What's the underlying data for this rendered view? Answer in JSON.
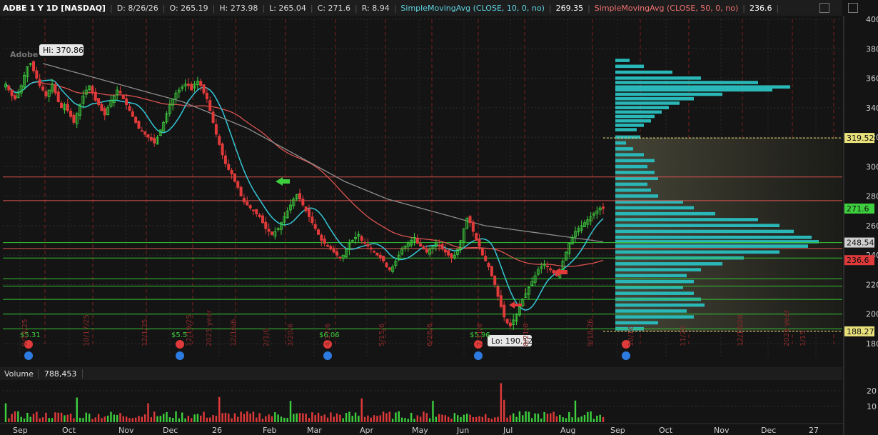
{
  "header": {
    "symbol": "ADBE 1 Y 1D [NASDAQ]",
    "date": "D: 8/26/26",
    "open": "O: 265.19",
    "high": "H: 273.98",
    "low": "L: 265.04",
    "close": "C: 271.6",
    "range": "R: 8.94",
    "sma10_label": "SimpleMovingAvg (CLOSE, 10, 0, no)",
    "sma10_value": "269.35",
    "sma50_label": "SimpleMovingAvg (CLOSE, 50, 0, no)",
    "sma50_value": "236.6",
    "logo_text": "Adobe"
  },
  "volume_header": {
    "label": "Volume",
    "value": "788,453"
  },
  "colors": {
    "up": "#3ecf3e",
    "down": "#e03a3a",
    "sma10": "#34c7d6",
    "sma50": "#d9534f",
    "sma200": "#8c8c8c",
    "profile": "#2ab7b7",
    "hline_red": "#d9534f",
    "hline_green": "#35c435",
    "hline_yellow": "#e8e07a"
  },
  "chart_data": {
    "type": "candlestick",
    "symbol": "ADBE",
    "price_axis": {
      "min": 180,
      "max": 400,
      "ticks": [
        180,
        200,
        220,
        240,
        260,
        280,
        300,
        320,
        340,
        360,
        380,
        400
      ]
    },
    "volume_axis": {
      "ticks": [
        10,
        20
      ]
    },
    "x_labels": [
      "Sep",
      "Oct",
      "Nov",
      "Dec",
      "26",
      "Feb",
      "Mar",
      "Apr",
      "May",
      "Jun",
      "Jul",
      "Aug",
      "Sep",
      "Oct",
      "Nov",
      "Dec",
      "27"
    ],
    "highlighted_prices": [
      {
        "value": "319.52",
        "color": "#e8e07a"
      },
      {
        "value": "271.6",
        "color": "#3ecf3e"
      },
      {
        "value": "248.54",
        "color": "#d0d0d0"
      },
      {
        "value": "236.6",
        "color": "#e03a3a"
      },
      {
        "value": "188.27",
        "color": "#e8e07a"
      }
    ],
    "hi_label": "Hi: 370.86",
    "lo_label": "Lo: 190.12",
    "horizontal_lines": [
      {
        "price": 293,
        "color": "red"
      },
      {
        "price": 277,
        "color": "red"
      },
      {
        "price": 248.5,
        "color": "green"
      },
      {
        "price": 244.5,
        "color": "red"
      },
      {
        "price": 238,
        "color": "green"
      },
      {
        "price": 224,
        "color": "green"
      },
      {
        "price": 219,
        "color": "green"
      },
      {
        "price": 210,
        "color": "green"
      },
      {
        "price": 200,
        "color": "green"
      },
      {
        "price": 190,
        "color": "green"
      }
    ],
    "yellow_lines": [
      319.52,
      188.27
    ],
    "dividends": [
      {
        "label": "$5.31"
      },
      {
        "label": "$5.5"
      },
      {
        "label": "$6.06"
      },
      {
        "label": "$5.96"
      }
    ],
    "date_markers": [
      "9/18/25",
      "10/17/25",
      "12/1/25",
      "12/19/25",
      "2025 year",
      "12/16/6",
      "2/1/6",
      "3/20/6",
      "4/17/6",
      "5/15/6",
      "6/26/6",
      "7/31/6",
      "8/21/6",
      "9/18/26",
      "10/16",
      "11/20",
      "12/18/26",
      "2026 year",
      "1/15"
    ],
    "close_series": [
      356,
      352,
      348,
      346,
      350,
      355,
      362,
      368,
      370,
      365,
      360,
      355,
      352,
      348,
      352,
      356,
      350,
      344,
      340,
      342,
      338,
      334,
      330,
      336,
      342,
      348,
      352,
      355,
      350,
      345,
      342,
      338,
      335,
      340,
      345,
      348,
      352,
      350,
      346,
      342,
      338,
      334,
      330,
      326,
      324,
      322,
      320,
      318,
      316,
      320,
      325,
      330,
      336,
      342,
      346,
      350,
      352,
      354,
      356,
      355,
      352,
      356,
      358,
      355,
      350,
      346,
      338,
      330,
      322,
      315,
      308,
      302,
      298,
      295,
      290,
      286,
      280,
      276,
      274,
      272,
      270,
      268,
      266,
      262,
      258,
      256,
      254,
      256,
      258,
      262,
      266,
      270,
      274,
      278,
      281,
      278,
      274,
      270,
      266,
      262,
      258,
      254,
      250,
      248,
      246,
      244,
      242,
      240,
      238,
      240,
      244,
      248,
      250,
      252,
      254,
      250,
      248,
      246,
      244,
      242,
      240,
      238,
      236,
      232,
      230,
      232,
      236,
      240,
      244,
      246,
      248,
      250,
      252,
      248,
      246,
      244,
      242,
      244,
      246,
      248,
      246,
      244,
      242,
      240,
      238,
      240,
      244,
      250,
      258,
      265,
      262,
      256,
      250,
      246,
      240,
      236,
      232,
      226,
      220,
      212,
      205,
      198,
      194,
      192,
      196,
      200,
      206,
      210,
      214,
      218,
      222,
      226,
      230,
      232,
      234,
      232,
      230,
      228,
      226,
      230,
      236,
      242,
      248,
      252,
      256,
      258,
      260,
      262,
      264,
      266,
      268,
      270,
      272,
      271.6
    ],
    "sma200_series": [
      370,
      368,
      366,
      364,
      362,
      360,
      358,
      356,
      354,
      352,
      350,
      348,
      346,
      344,
      341,
      338,
      335,
      332,
      329,
      326,
      322,
      318,
      314,
      310,
      306,
      302,
      298,
      294,
      290,
      287,
      284,
      281,
      278,
      276,
      274,
      272,
      270,
      268,
      266,
      264,
      262,
      260,
      259,
      258,
      257,
      256,
      255,
      254,
      253,
      252,
      251,
      250,
      249
    ],
    "volume_ticks_note": "volume bars in millions"
  }
}
